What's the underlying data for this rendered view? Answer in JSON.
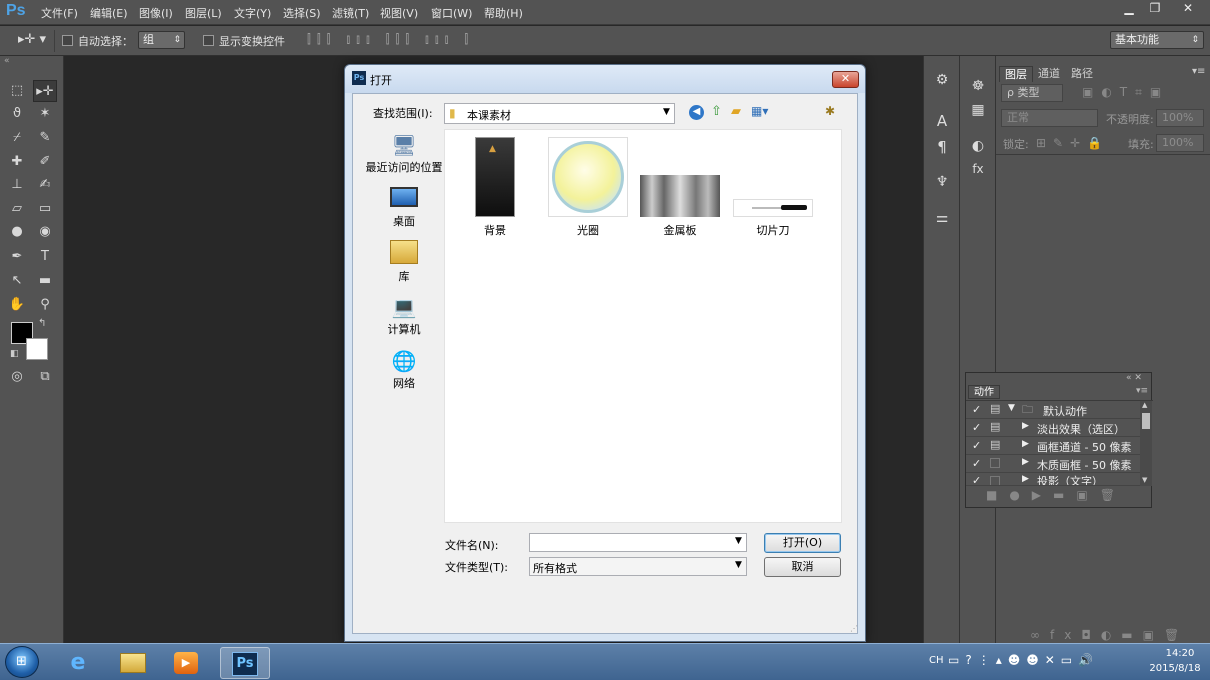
{
  "app": {
    "logo": "Ps"
  },
  "menu": [
    "文件(F)",
    "编辑(E)",
    "图像(I)",
    "图层(L)",
    "文字(Y)",
    "选择(S)",
    "滤镜(T)",
    "视图(V)",
    "窗口(W)",
    "帮助(H)"
  ],
  "options": {
    "auto_select_label": "自动选择：",
    "auto_select_value": "组",
    "show_transform_label": "显示变换控件",
    "workspace": "基本功能"
  },
  "layers_panel": {
    "tabs": [
      "图层",
      "通道",
      "路径"
    ],
    "filter_value": "ρ 类型",
    "blend_mode": "正常",
    "opacity_label": "不透明度:",
    "opacity_value": "100%",
    "lock_label": "锁定:",
    "fill_label": "填充:",
    "fill_value": "100%"
  },
  "actions_panel": {
    "title": "动作",
    "rows": [
      {
        "label": "默认动作"
      },
      {
        "label": "淡出效果（选区）"
      },
      {
        "label": "画框通道 - 50 像素"
      },
      {
        "label": "木质画框 - 50 像素"
      },
      {
        "label": "投影（文字）"
      }
    ]
  },
  "dialog": {
    "title": "打开",
    "lookin_label": "查找范围(I):",
    "folder": "本课素材",
    "places": [
      "最近访问的位置",
      "桌面",
      "库",
      "计算机",
      "网络"
    ],
    "files": [
      "背景",
      "光圈",
      "金属板",
      "切片刀"
    ],
    "filename_label": "文件名(N):",
    "filename_value": "",
    "filetype_label": "文件类型(T):",
    "filetype_value": "所有格式",
    "open_btn": "打开(O)",
    "cancel_btn": "取消"
  },
  "taskbar": {
    "lang": "CH",
    "time": "14:20",
    "date": "2015/8/18",
    "active_app": "Ps"
  }
}
